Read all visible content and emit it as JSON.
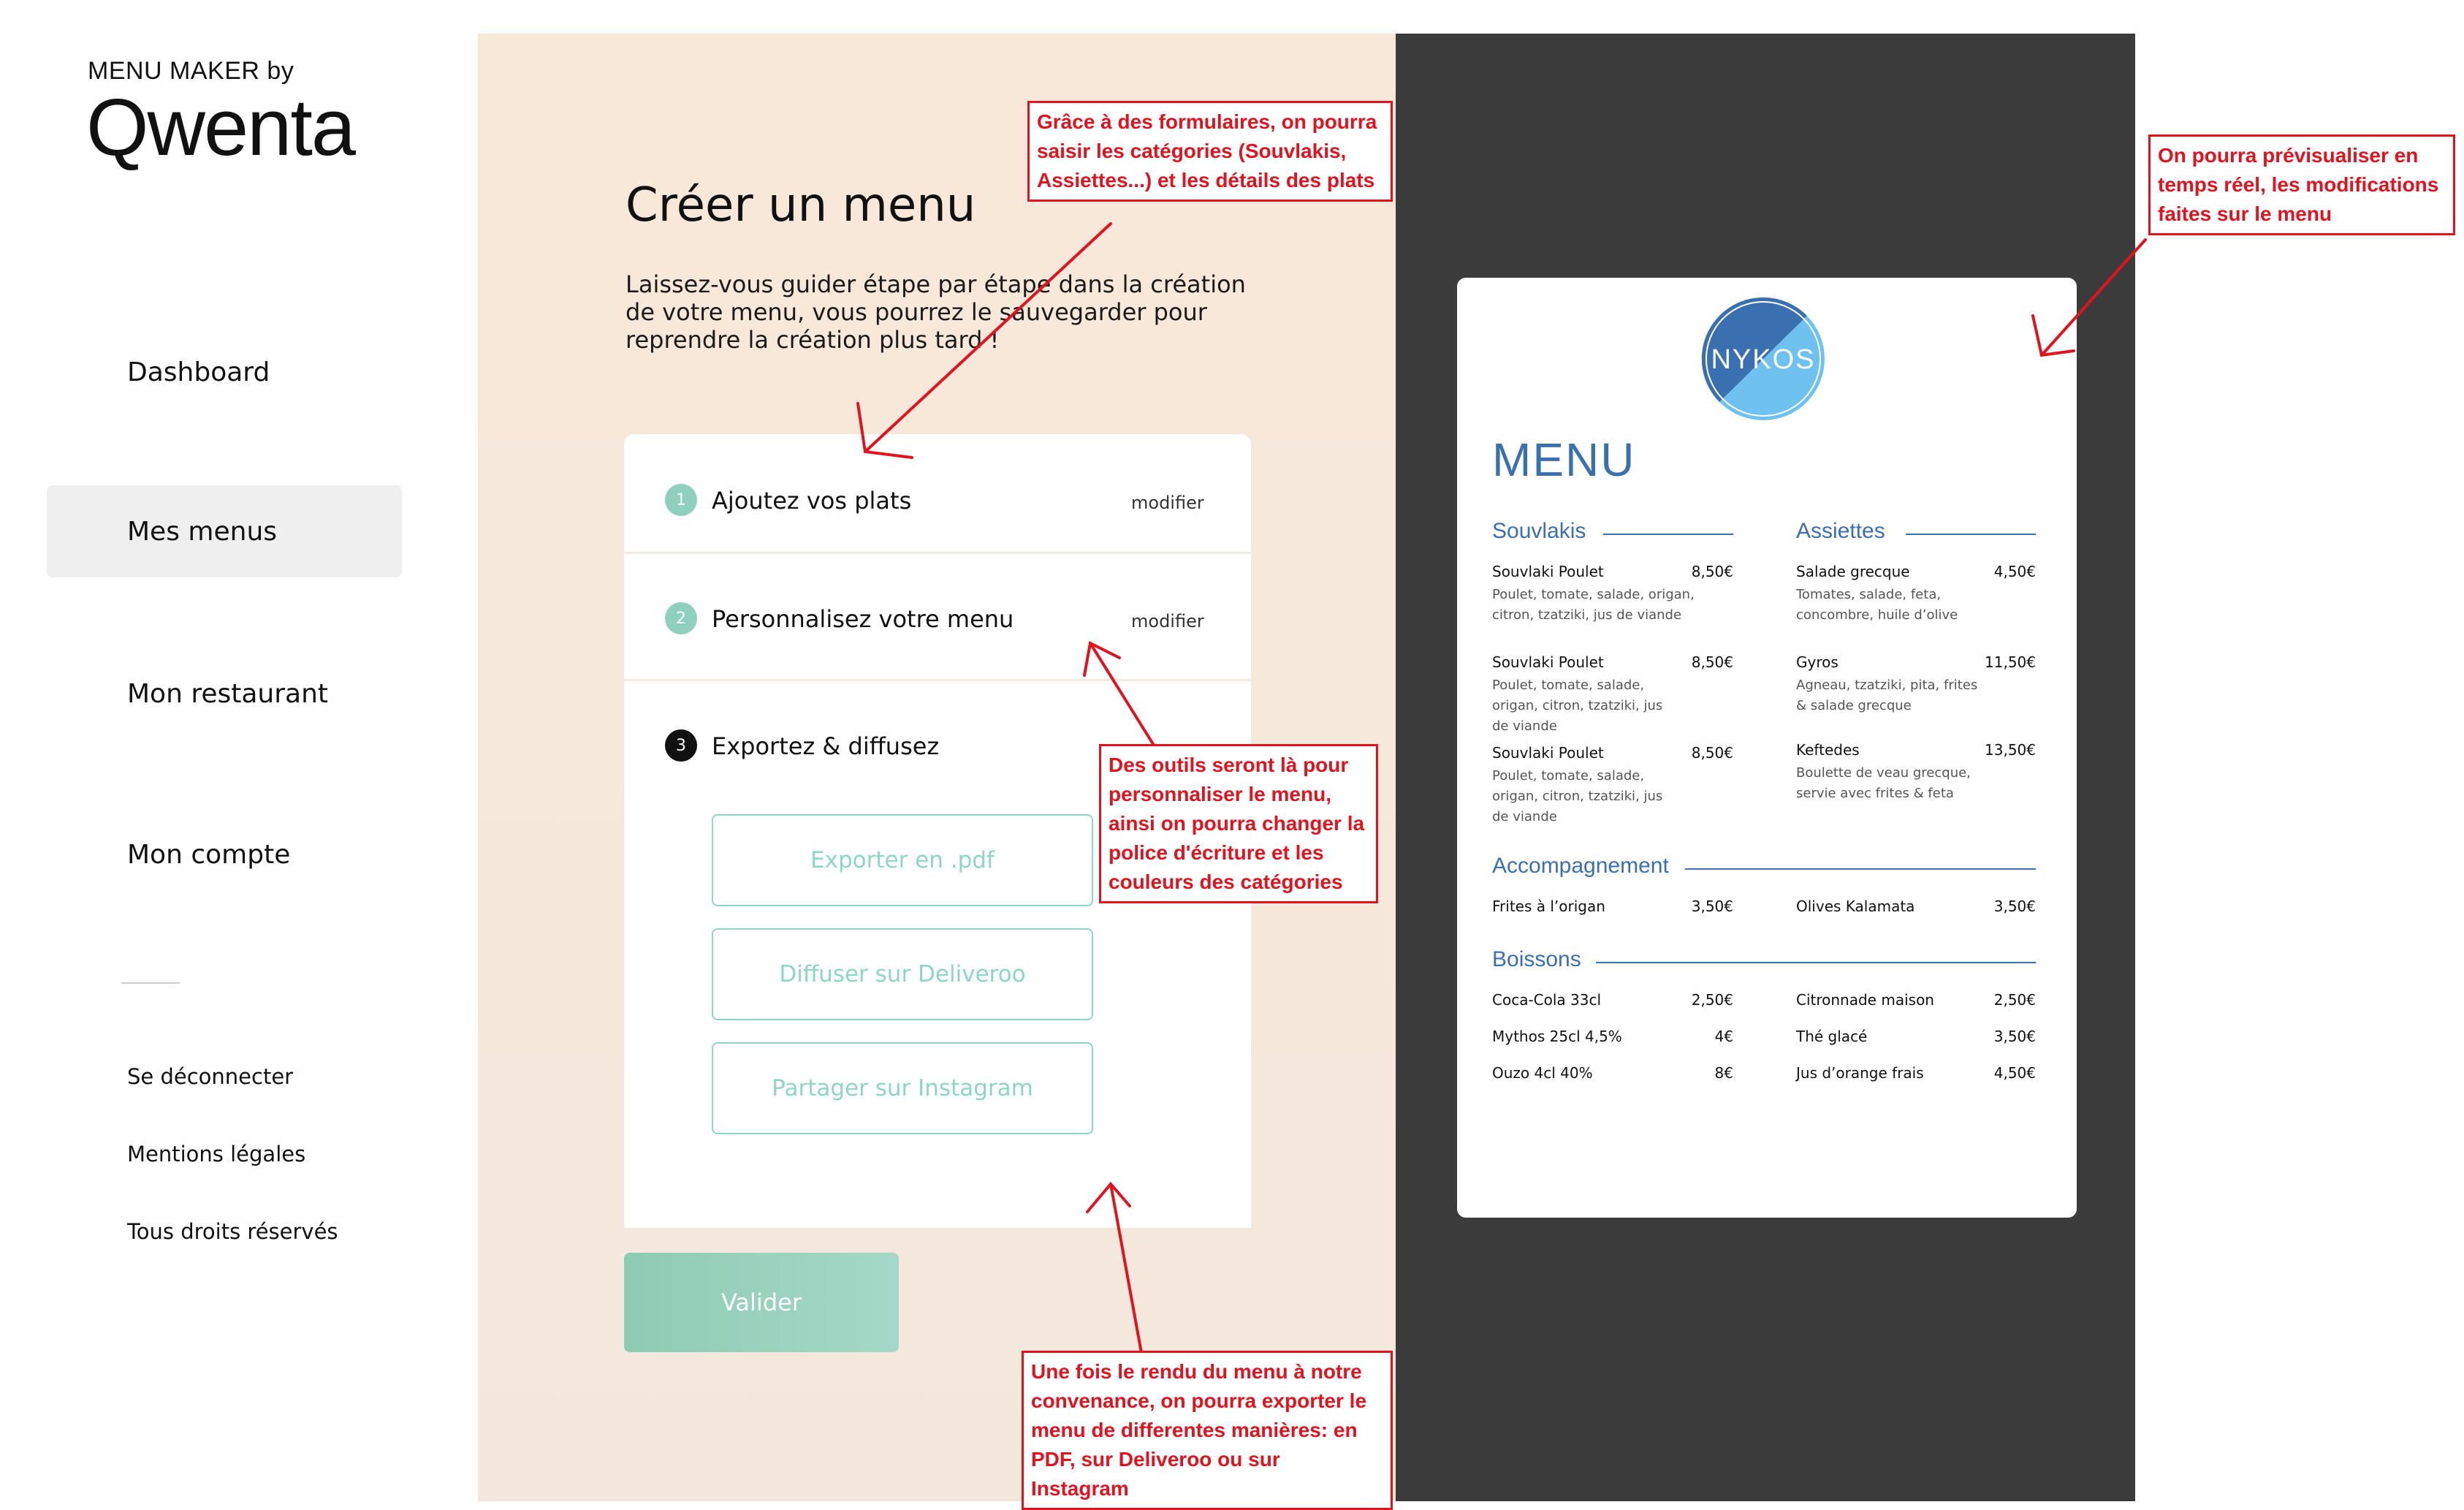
{
  "brand": {
    "tagline": "MENU MAKER by",
    "logo_text": "Qwenta"
  },
  "sidebar": {
    "nav": [
      {
        "label": "Dashboard",
        "active": false
      },
      {
        "label": "Mes menus",
        "active": true
      },
      {
        "label": "Mon restaurant",
        "active": false
      },
      {
        "label": "Mon compte",
        "active": false
      }
    ],
    "footer": [
      {
        "label": "Se déconnecter"
      },
      {
        "label": "Mentions légales"
      },
      {
        "label": "Tous droits réservés"
      }
    ]
  },
  "main": {
    "title": "Créer un menu",
    "intro": "Laissez-vous guider étape par étape dans la création de votre menu, vous pourrez le sauvegarder pour reprendre la création plus tard !",
    "steps": [
      {
        "number": "1",
        "label": "Ajoutez vos plats",
        "edit_label": "modifier",
        "status": "done"
      },
      {
        "number": "2",
        "label": "Personnalisez votre menu",
        "edit_label": "modifier",
        "status": "done"
      },
      {
        "number": "3",
        "label": "Exportez & diffusez",
        "status": "current"
      }
    ],
    "export_actions": [
      {
        "label": "Exporter en .pdf"
      },
      {
        "label": "Diffuser sur Deliveroo"
      },
      {
        "label": "Partager sur Instagram"
      }
    ],
    "validate_label": "Valider"
  },
  "preview": {
    "logo_text": "NYKOS",
    "menu_title": "MENU",
    "accent_color": "#3a6fb0",
    "categories": {
      "souvlakis": {
        "title": "Souvlakis",
        "items": [
          {
            "name": "Souvlaki Poulet",
            "price": "8,50€",
            "desc": "Poulet, tomate, salade, origan, citron, tzatziki, jus de viande"
          },
          {
            "name": "Souvlaki Poulet",
            "price": "8,50€",
            "desc": "Poulet, tomate, salade, origan, citron, tzatziki, jus de viande"
          },
          {
            "name": "Souvlaki Poulet",
            "price": "8,50€",
            "desc": "Poulet, tomate, salade, origan, citron, tzatziki, jus de viande"
          }
        ]
      },
      "assiettes": {
        "title": "Assiettes",
        "items": [
          {
            "name": "Salade grecque",
            "price": "4,50€",
            "desc": "Tomates, salade, feta, concombre, huile d’olive"
          },
          {
            "name": "Gyros",
            "price": "11,50€",
            "desc": "Agneau, tzatziki, pita, frites & salade grecque"
          },
          {
            "name": "Keftedes",
            "price": "13,50€",
            "desc": "Boulette de veau grecque, servie avec frites & feta"
          }
        ]
      },
      "accompagnement": {
        "title": "Accompagnement",
        "items": [
          {
            "name": "Frites à l’origan",
            "price": "3,50€"
          },
          {
            "name": "Olives Kalamata",
            "price": "3,50€"
          }
        ]
      },
      "boissons": {
        "title": "Boissons",
        "items": [
          {
            "name": "Coca-Cola 33cl",
            "price": "2,50€"
          },
          {
            "name": "Citronnade maison",
            "price": "2,50€"
          },
          {
            "name": "Mythos 25cl 4,5%",
            "price": "4€"
          },
          {
            "name": "Thé glacé",
            "price": "3,50€"
          },
          {
            "name": "Ouzo 4cl 40%",
            "price": "8€"
          },
          {
            "name": "Jus d’orange frais",
            "price": "4,50€"
          }
        ]
      }
    }
  },
  "annotations": {
    "forms": "Grâce à des formulaires, on pourra saisir les catégories (Souvlakis, Assiettes...) et les détails des plats",
    "preview": "On pourra prévisualiser en temps réel, les modifications faites sur le menu",
    "tools": "Des outils seront là pour personnaliser le menu, ainsi on pourra changer la police d'écriture et les couleurs des catégories",
    "export": "Une fois le rendu du menu à notre convenance, on pourra exporter le menu de differentes manières: en PDF, sur Deliveroo ou sur Instagram",
    "color": "#e0141f"
  }
}
